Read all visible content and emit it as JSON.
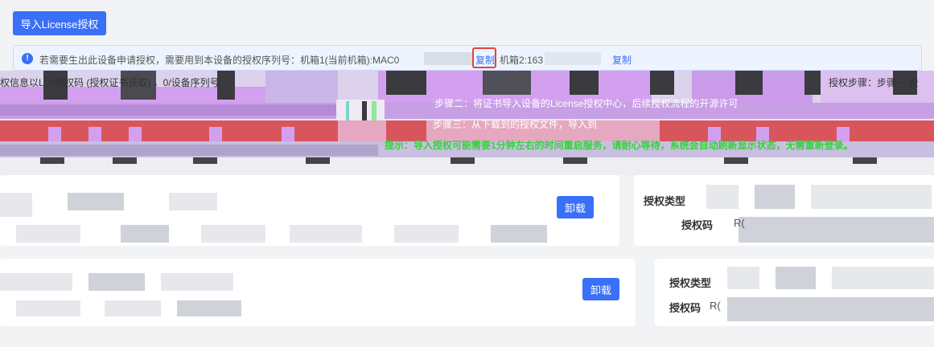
{
  "toolbar": {
    "import_label": "导入License授权"
  },
  "notice": {
    "icon": "!",
    "text": "若需要生出此设备申请授权，需要用到本设备的授权序列号：机箱1(当前机箱):MAC0",
    "copy_label": "复制",
    "dev2_text": "机箱2:163",
    "copy_label2": "复制"
  },
  "glitch": {
    "row1_left": "权信息以L: 0授权码 (授权证书获取)  ，0/设备序列号",
    "row1_right": "授权步骤：步骤一 授",
    "row2": "步骤二：将证书导入设备的License授权中心，后续授权流程的开源许可",
    "row3": "步骤三：从下载到的授权文件，导入到",
    "row4": "提示：导入授权可能需要1分钟左右的时间重启服务，请耐心等待，系统会自动刷新显示状态，无需重新登录。"
  },
  "cards": [
    {
      "unload_label": "卸载",
      "type_label": "授权类型",
      "code_label": "授权码",
      "code_value": "R("
    },
    {
      "unload_label": "卸载",
      "type_label": "授权类型",
      "code_label": "授权码",
      "code_value": "R("
    }
  ],
  "colors": {
    "primary": "#3a6ff7",
    "highlight": "#e0453a",
    "glitch_purple": "#d3a0ef",
    "glitch_red": "#d9555c",
    "glitch_green": "#36d13e"
  }
}
